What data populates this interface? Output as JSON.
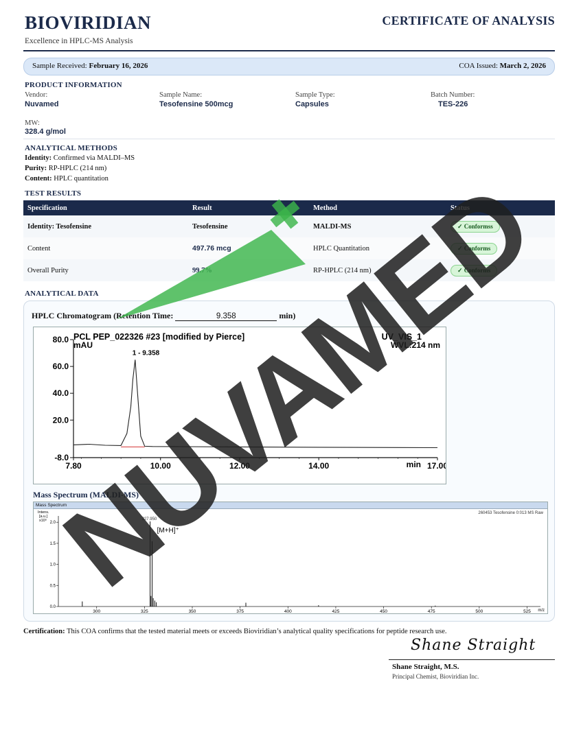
{
  "header": {
    "brand": "BIOVIRIDIAN",
    "tagline": "Excellence in HPLC-MS Analysis",
    "doc_title": "CERTIFICATE OF ANALYSIS"
  },
  "banner": {
    "received_label": "Sample Received:",
    "received_value": "February 16, 2026",
    "issued_label": "COA Issued:",
    "issued_value": "March 2, 2026"
  },
  "product": {
    "heading": "PRODUCT INFORMATION",
    "vendor_label": "Vendor:",
    "vendor": "Nuvamed",
    "name_label": "Sample Name:",
    "name": "Tesofensine 500mcg",
    "type_label": "Sample Type:",
    "type": "Capsules",
    "batch_label": "Batch Number:",
    "batch": "TES-226",
    "mw_label": "MW:",
    "mw": "328.4 g/mol"
  },
  "methods": {
    "heading": "ANALYTICAL METHODS",
    "identity_label": "Identity:",
    "identity": "Confirmed via MALDI–MS",
    "purity_label": "Purity:",
    "purity": "RP-HPLC (214 nm)",
    "content_label": "Content:",
    "content": "HPLC quantitation"
  },
  "results": {
    "heading": "TEST RESULTS",
    "columns": [
      "Specification",
      "Result",
      "Method",
      "Status"
    ],
    "rows": [
      {
        "spec": "Identity:  Tesofensine",
        "result": "Tesofensine",
        "method": "MALDI-MS",
        "status": "✓ Conformss"
      },
      {
        "spec": "Content",
        "result": "497.76  mcg",
        "method": "HPLC Quantitation",
        "status": "✓ Conforms"
      },
      {
        "spec": "Overall Purity",
        "result": "99.7%",
        "method": "RP-HPLC (214 nm)",
        "status": "✓ Conforms"
      }
    ]
  },
  "analytical": {
    "heading": "ANALYTICAL DATA",
    "hplc_title_prefix": "HPLC Chromatogram (Retention Time:",
    "retention_time": "9.358",
    "hplc_title_suffix": "min)",
    "ms_title": "Mass Spectrum (MALDI-MS)"
  },
  "chart_data": [
    {
      "type": "line",
      "header_left": "PCL PEP_022326 #23 [modified by Pierce]",
      "header_right_1": "UV_VIS_1",
      "header_right_2": "WVL:214 nm",
      "ylabel": "mAU",
      "xlabel": "min",
      "ylim": [
        -8,
        80
      ],
      "xlim": [
        7.8,
        17.0
      ],
      "yticks": [
        "80.0",
        "60.0",
        "40.0",
        "20.0",
        "-8.0"
      ],
      "xticks": [
        "7.80",
        "10.00",
        "12.00",
        "14.00",
        "17.00"
      ],
      "peak_label": "1 - 9.358",
      "series": [
        {
          "x": [
            7.8,
            8.2,
            8.6,
            9.0,
            9.15,
            9.25,
            9.3,
            9.358,
            9.42,
            9.5,
            9.6,
            9.8,
            10.5,
            12.0,
            14.0,
            16.0,
            17.0
          ],
          "y": [
            1.5,
            2.0,
            1.2,
            1.0,
            10,
            30,
            50,
            65,
            40,
            8,
            0.5,
            0.3,
            0.2,
            0.0,
            -0.3,
            -0.5,
            -0.6
          ]
        }
      ],
      "colors": {
        "trace": "#222222",
        "baseline": "#d33333"
      }
    },
    {
      "type": "bar",
      "panel_title": "Mass Spectrum",
      "header_right": "260453 Tesofensine 0:013 MS Raw",
      "ylabel_lines": [
        "Intens.",
        "[a.u.]",
        "x10⁵"
      ],
      "xlabel": "m/z",
      "yticks": [
        "2.0",
        "1.5",
        "1.0",
        "0.5",
        "0.0"
      ],
      "xticks": [
        "300",
        "325",
        "350",
        "375",
        "400",
        "425",
        "450",
        "475",
        "500",
        "525"
      ],
      "xlim": [
        280,
        532
      ],
      "ylim": [
        0,
        2.15
      ],
      "main_peak_label": "327.950",
      "annotation": "[M+H]⁺",
      "peaks": [
        {
          "mz": 292.5,
          "i": 0.12
        },
        {
          "mz": 327.95,
          "i": 2.02
        },
        {
          "mz": 328.4,
          "i": 0.25
        },
        {
          "mz": 329.0,
          "i": 1.55
        },
        {
          "mz": 329.6,
          "i": 0.2
        },
        {
          "mz": 330.4,
          "i": 0.14
        },
        {
          "mz": 331.2,
          "i": 0.1
        },
        {
          "mz": 378.0,
          "i": 0.09
        },
        {
          "mz": 416.0,
          "i": 0.03
        },
        {
          "mz": 477.0,
          "i": 0.02
        }
      ]
    }
  ],
  "certification": {
    "label": "Certification:",
    "text": "This COA confirms that the tested material meets or exceeds Bioviridian’s analytical quality specifications for peptide research use."
  },
  "signature": {
    "script": "Shane Straight",
    "name": "Shane Straight, M.S.",
    "title": "Principal Chemist, Bioviridian Inc."
  },
  "watermark": {
    "text": "NUVAMED",
    "colors": {
      "dark": "#1f1f1f",
      "accent": "#3cb54a"
    }
  }
}
